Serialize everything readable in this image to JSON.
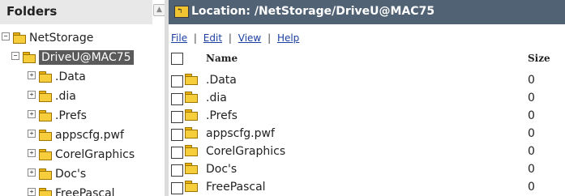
{
  "folders_panel": {
    "title": "Folders",
    "tree": [
      {
        "label": "NetStorage",
        "expander": "−",
        "level": 0,
        "selected": false
      },
      {
        "label": "DriveU@MAC75",
        "expander": "−",
        "level": 1,
        "selected": true
      },
      {
        "label": ".Data",
        "expander": "+",
        "level": 2,
        "selected": false
      },
      {
        "label": ".dia",
        "expander": "+",
        "level": 2,
        "selected": false
      },
      {
        "label": ".Prefs",
        "expander": "+",
        "level": 2,
        "selected": false
      },
      {
        "label": "appscfg.pwf",
        "expander": "+",
        "level": 2,
        "selected": false
      },
      {
        "label": "CorelGraphics",
        "expander": "+",
        "level": 2,
        "selected": false
      },
      {
        "label": "Doc's",
        "expander": "+",
        "level": 2,
        "selected": false
      },
      {
        "label": "FreePascal",
        "expander": "+",
        "level": 2,
        "selected": false
      }
    ],
    "scroll_up_icon": "triangle-up"
  },
  "location_bar": {
    "icon": "folder-up-icon",
    "text": "Location: /NetStorage/DriveU@MAC75",
    "bg_color": "#516274"
  },
  "menu": {
    "file": "File",
    "edit": "Edit",
    "view": "View",
    "help": "Help",
    "separator": "|"
  },
  "file_list": {
    "columns": {
      "name": "Name",
      "size": "Size"
    },
    "rows": [
      {
        "name": ".Data",
        "size": "0"
      },
      {
        "name": ".dia",
        "size": "0"
      },
      {
        "name": ".Prefs",
        "size": "0"
      },
      {
        "name": "appscfg.pwf",
        "size": "0"
      },
      {
        "name": "CorelGraphics",
        "size": "0"
      },
      {
        "name": "Doc's",
        "size": "0"
      },
      {
        "name": "FreePascal",
        "size": "0"
      }
    ]
  }
}
